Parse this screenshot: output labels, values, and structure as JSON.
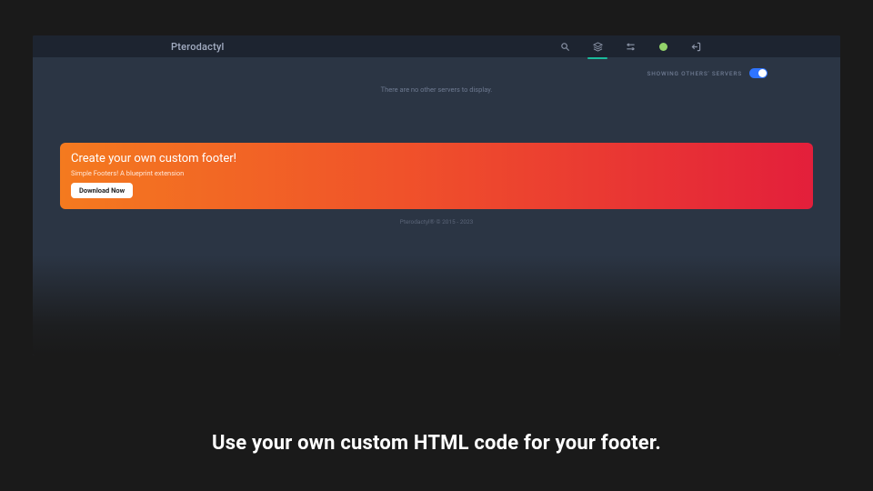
{
  "brand": "Pterodactyl",
  "toggle": {
    "label": "SHOWING OTHERS' SERVERS",
    "on": true
  },
  "empty_message": "There are no other servers to display.",
  "footer_banner": {
    "title": "Create your own custom footer!",
    "subtitle": "Simple Footers! A blueprint extension",
    "button": "Download Now"
  },
  "copyright": "Pterodactyl® © 2015 - 2023",
  "caption": "Use your own custom HTML code for your footer.",
  "nav": {
    "search": "search-icon",
    "servers": "layers-icon",
    "admin": "sliders-icon",
    "logout": "logout-icon"
  }
}
